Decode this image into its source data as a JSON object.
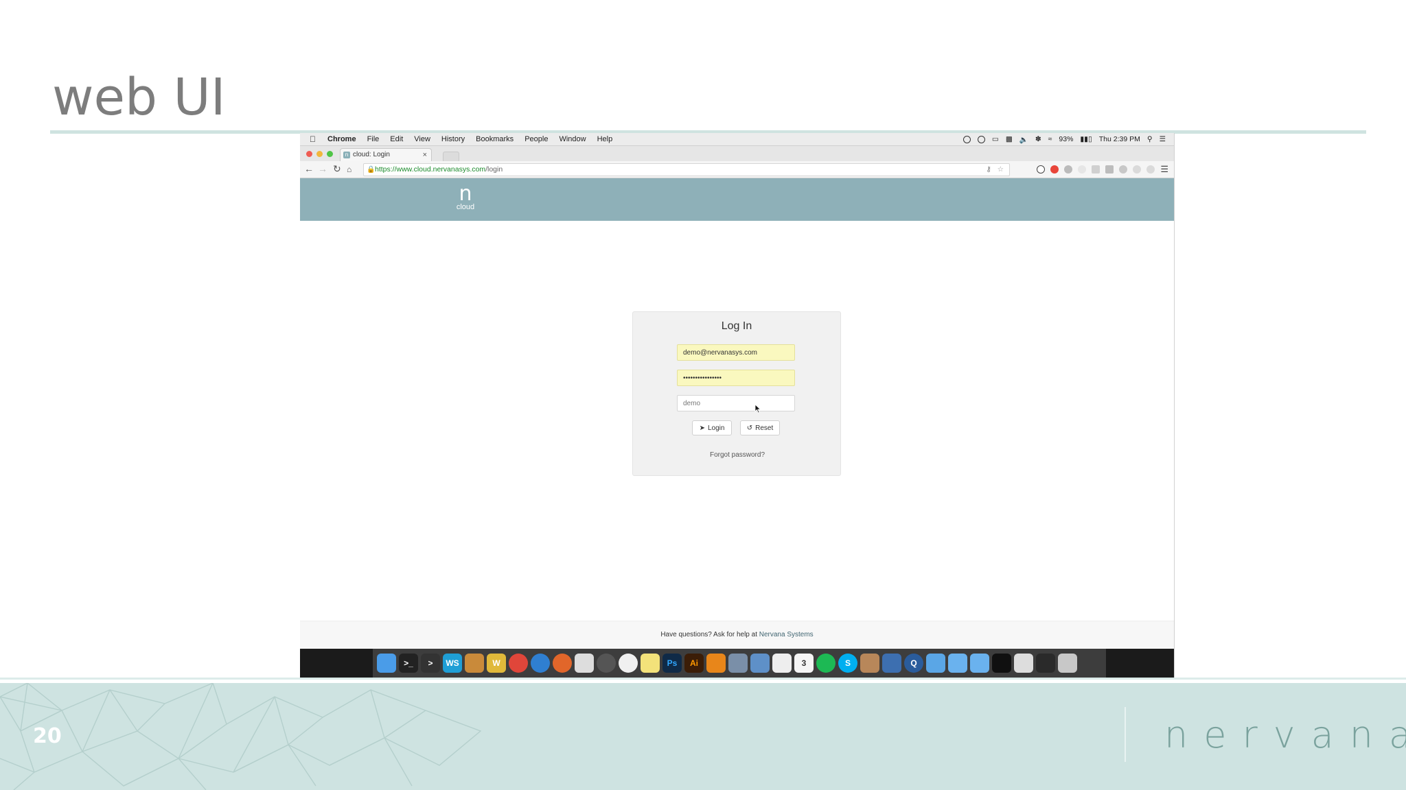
{
  "slide": {
    "title": "web UI",
    "page_number": "20",
    "brand": "nervana"
  },
  "menubar": {
    "app": "Chrome",
    "menus": [
      "File",
      "Edit",
      "View",
      "History",
      "Bookmarks",
      "People",
      "Window",
      "Help"
    ],
    "battery": "93%",
    "clock": "Thu 2:39 PM"
  },
  "browser": {
    "tab_title": "cloud: Login",
    "favicon_glyph": "n",
    "url_host": "https://www.cloud.nervanasys.com",
    "url_path": "/login"
  },
  "site": {
    "logo_glyph": "n",
    "logo_word": "cloud",
    "header_color": "#8eb0b8"
  },
  "login": {
    "title": "Log In",
    "email_value": "demo@nervanasys.com",
    "password_value": "••••••••••••••••",
    "tenant_placeholder": "demo",
    "login_label": "Login",
    "reset_label": "Reset",
    "forgot_label": "Forgot password?"
  },
  "footer": {
    "text": "Have questions? Ask for help at ",
    "link": "Nervana Systems"
  },
  "dock": {
    "apps": [
      {
        "name": "finder-icon",
        "color": "#4a9ce8",
        "glyph": ""
      },
      {
        "name": "terminal-icon",
        "color": "#222222",
        "glyph": ">_"
      },
      {
        "name": "terminal-alt-icon",
        "color": "#333333",
        "glyph": ">"
      },
      {
        "name": "webstorm-icon",
        "color": "#1f9fd6",
        "glyph": "WS"
      },
      {
        "name": "scanner-icon",
        "color": "#c98a3a",
        "glyph": ""
      },
      {
        "name": "wunderlist-icon",
        "color": "#e0b93a",
        "glyph": "W"
      },
      {
        "name": "chrome-icon",
        "color": "#e0463a",
        "glyph": ""
      },
      {
        "name": "safari-icon",
        "color": "#2f7fd1",
        "glyph": ""
      },
      {
        "name": "firefox-icon",
        "color": "#e1662a",
        "glyph": ""
      },
      {
        "name": "launchpad-icon",
        "color": "#dddddd",
        "glyph": ""
      },
      {
        "name": "compass-icon",
        "color": "#555555",
        "glyph": ""
      },
      {
        "name": "smiley-icon",
        "color": "#f0f0f0",
        "glyph": ""
      },
      {
        "name": "notes-icon",
        "color": "#f3e27a",
        "glyph": ""
      },
      {
        "name": "photoshop-icon",
        "color": "#0f2a47",
        "glyph": "Ps"
      },
      {
        "name": "illustrator-icon",
        "color": "#3b1d07",
        "glyph": "Ai"
      },
      {
        "name": "vlc-icon",
        "color": "#e8861a",
        "glyph": ""
      },
      {
        "name": "image-viewer-icon",
        "color": "#7a8fa8",
        "glyph": ""
      },
      {
        "name": "preview-icon",
        "color": "#5e90c8",
        "glyph": ""
      },
      {
        "name": "textedit-icon",
        "color": "#eeeeee",
        "glyph": ""
      },
      {
        "name": "calendar-icon",
        "color": "#f5f5f5",
        "glyph": "3"
      },
      {
        "name": "spotify-icon",
        "color": "#1db954",
        "glyph": ""
      },
      {
        "name": "skype-icon",
        "color": "#00aff0",
        "glyph": "S"
      },
      {
        "name": "books-icon",
        "color": "#b8875a",
        "glyph": ""
      },
      {
        "name": "virtualbox-icon",
        "color": "#3d6fb0",
        "glyph": ""
      },
      {
        "name": "quicktime-icon",
        "color": "#2a5c9c",
        "glyph": "Q"
      },
      {
        "name": "folder-apps-icon",
        "color": "#5aa6e6",
        "glyph": ""
      },
      {
        "name": "folder-docs-icon",
        "color": "#6ab2ee",
        "glyph": ""
      },
      {
        "name": "folder-downloads-icon",
        "color": "#6ab2ee",
        "glyph": ""
      },
      {
        "name": "terminal-window-icon",
        "color": "#101010",
        "glyph": ""
      },
      {
        "name": "screenshot-icon",
        "color": "#dddddd",
        "glyph": ""
      },
      {
        "name": "display-icon",
        "color": "#2a2a2a",
        "glyph": ""
      },
      {
        "name": "trash-icon",
        "color": "#c8c8c8",
        "glyph": ""
      }
    ]
  }
}
